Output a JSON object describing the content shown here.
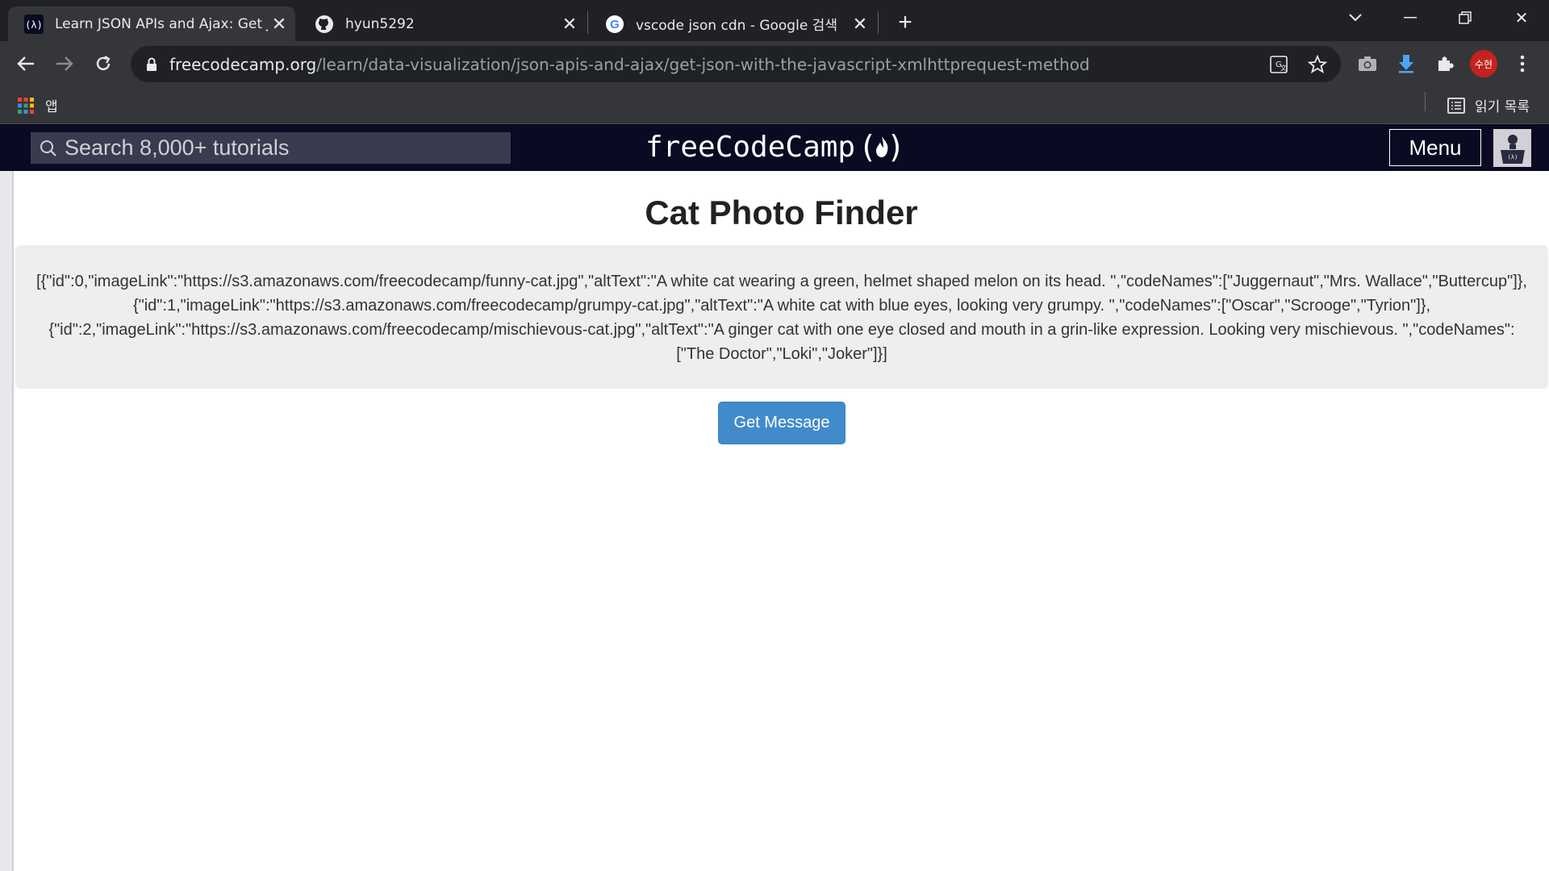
{
  "browser": {
    "tabs": [
      {
        "title": "Learn JSON APIs and Ajax: Get JSON with the JavaScript XMLHttpRequest Method",
        "icon": "freecodecamp-favicon",
        "active": true
      },
      {
        "title": "hyun5292",
        "icon": "github-icon",
        "active": false
      },
      {
        "title": "vscode json cdn - Google 검색",
        "icon": "google-icon",
        "active": false
      }
    ],
    "url_host": "freecodecamp.org",
    "url_path": "/learn/data-visualization/json-apis-and-ajax/get-json-with-the-javascript-xmlhttprequest-method",
    "profile_label": "수현",
    "bookmarks": {
      "apps_label": "앱",
      "reading_list_label": "읽기 목록"
    }
  },
  "fcc_nav": {
    "search_placeholder": "Search 8,000+ tutorials",
    "logo_text": "freeCodeCamp",
    "menu_label": "Menu"
  },
  "page": {
    "title": "Cat Photo Finder",
    "message": "[{\"id\":0,\"imageLink\":\"https://s3.amazonaws.com/freecodecamp/funny-cat.jpg\",\"altText\":\"A white cat wearing a green, helmet shaped melon on its head. \",\"codeNames\":[\"Juggernaut\",\"Mrs. Wallace\",\"Buttercup\"]},{\"id\":1,\"imageLink\":\"https://s3.amazonaws.com/freecodecamp/grumpy-cat.jpg\",\"altText\":\"A white cat with blue eyes, looking very grumpy. \",\"codeNames\":[\"Oscar\",\"Scrooge\",\"Tyrion\"]},{\"id\":2,\"imageLink\":\"https://s3.amazonaws.com/freecodecamp/mischievous-cat.jpg\",\"altText\":\"A ginger cat with one eye closed and mouth in a grin-like expression. Looking very mischievous. \",\"codeNames\":[\"The Doctor\",\"Loki\",\"Joker\"]}]",
    "button_label": "Get Message"
  },
  "colors": {
    "fcc_nav_bg": "#0a0a23",
    "button_bg": "#428bca",
    "message_bg": "#eeeeee",
    "chrome_dark": "#202124"
  }
}
